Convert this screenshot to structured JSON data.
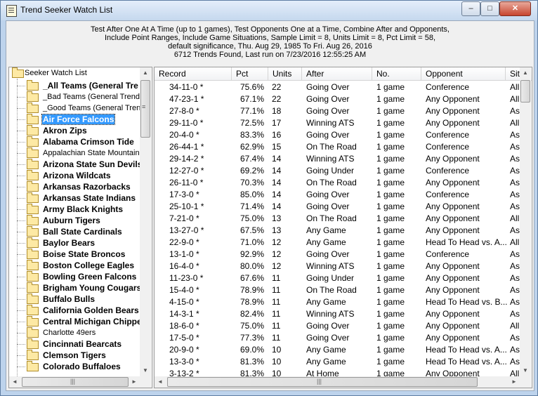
{
  "window": {
    "title": "Trend Seeker Watch List",
    "minimize_glyph": "–",
    "maximize_glyph": "□",
    "close_glyph": "✕"
  },
  "info": {
    "line1": "Test After One At A Time (up to 1 games), Test Opponents One at a Time, Combine After and Opponents,",
    "line2": "Include Point Ranges, Include Game Situations,  Sample Limit = 8,  Units Limit = 8,  Pct Limit = 58,",
    "line3": "default significance, Thu. Aug 29, 1985 To Fri. Aug 26, 2016",
    "line4": "6712 Trends Found, Last run on 7/23/2016 12:55:25 AM"
  },
  "tree": {
    "root_label": "Seeker Watch List",
    "selected_index": 3,
    "items": [
      {
        "label": "_All Teams (General Tre",
        "bold": true
      },
      {
        "label": "_Bad Teams (General Trends",
        "bold": false
      },
      {
        "label": "_Good Teams (General Trend",
        "bold": false
      },
      {
        "label": "Air Force Falcons",
        "bold": true
      },
      {
        "label": "Akron Zips",
        "bold": true
      },
      {
        "label": "Alabama Crimson Tide",
        "bold": true
      },
      {
        "label": "Appalachian State Mountaine",
        "bold": false
      },
      {
        "label": "Arizona State Sun Devils",
        "bold": true
      },
      {
        "label": "Arizona Wildcats",
        "bold": true
      },
      {
        "label": "Arkansas Razorbacks",
        "bold": true
      },
      {
        "label": "Arkansas State Indians",
        "bold": true
      },
      {
        "label": "Army Black Knights",
        "bold": true
      },
      {
        "label": "Auburn Tigers",
        "bold": true
      },
      {
        "label": "Ball State Cardinals",
        "bold": true
      },
      {
        "label": "Baylor Bears",
        "bold": true
      },
      {
        "label": "Boise State Broncos",
        "bold": true
      },
      {
        "label": "Boston College Eagles",
        "bold": true
      },
      {
        "label": "Bowling Green Falcons",
        "bold": true
      },
      {
        "label": "Brigham Young Cougars",
        "bold": true
      },
      {
        "label": "Buffalo Bulls",
        "bold": true
      },
      {
        "label": "California Golden Bears",
        "bold": true
      },
      {
        "label": "Central Michigan Chippe",
        "bold": true
      },
      {
        "label": "Charlotte 49ers",
        "bold": false
      },
      {
        "label": "Cincinnati Bearcats",
        "bold": true
      },
      {
        "label": "Clemson Tigers",
        "bold": true
      },
      {
        "label": "Colorado Buffaloes",
        "bold": true
      }
    ]
  },
  "table": {
    "columns": [
      "Record",
      "Pct",
      "Units",
      "After",
      "No.",
      "Opponent",
      "Situt"
    ],
    "rows": [
      [
        "34-11-0 *",
        "75.6%",
        "22",
        "Going Over",
        "1 game",
        "Conference",
        "All G"
      ],
      [
        "47-23-1 *",
        "67.1%",
        "22",
        "Going Over",
        "1 game",
        "Any Opponent",
        "All G"
      ],
      [
        "27-8-0 *",
        "77.1%",
        "18",
        "Going Over",
        "1 game",
        "Any Opponent",
        "As D"
      ],
      [
        "29-11-0 *",
        "72.5%",
        "17",
        "Winning ATS",
        "1 game",
        "Any Opponent",
        "All G"
      ],
      [
        "20-4-0 *",
        "83.3%",
        "16",
        "Going Over",
        "1 game",
        "Conference",
        "As A"
      ],
      [
        "26-44-1 *",
        "62.9%",
        "15",
        "On The Road",
        "1 game",
        "Conference",
        "As F"
      ],
      [
        "29-14-2 *",
        "67.4%",
        "14",
        "Winning ATS",
        "1 game",
        "Any Opponent",
        "As A"
      ],
      [
        "12-27-0 *",
        "69.2%",
        "14",
        "Going Under",
        "1 game",
        "Conference",
        "As F"
      ],
      [
        "26-11-0 *",
        "70.3%",
        "14",
        "On The Road",
        "1 game",
        "Any Opponent",
        "As A"
      ],
      [
        "17-3-0 *",
        "85.0%",
        "14",
        "Going Over",
        "1 game",
        "Conference",
        "As D"
      ],
      [
        "25-10-1 *",
        "71.4%",
        "14",
        "Going Over",
        "1 game",
        "Any Opponent",
        "As A"
      ],
      [
        "7-21-0 *",
        "75.0%",
        "13",
        "On The Road",
        "1 game",
        "Any Opponent",
        "All G"
      ],
      [
        "13-27-0 *",
        "67.5%",
        "13",
        "Any Game",
        "1 game",
        "Any Opponent",
        "As F"
      ],
      [
        "22-9-0 *",
        "71.0%",
        "12",
        "Any Game",
        "1 game",
        "Head To Head vs. A...",
        "All G"
      ],
      [
        "13-1-0 *",
        "92.9%",
        "12",
        "Going Over",
        "1 game",
        "Conference",
        "As D"
      ],
      [
        "16-4-0 *",
        "80.0%",
        "12",
        "Winning ATS",
        "1 game",
        "Any Opponent",
        "As A"
      ],
      [
        "11-23-0 *",
        "67.6%",
        "11",
        "Going Under",
        "1 game",
        "Any Opponent",
        "As H"
      ],
      [
        "15-4-0 *",
        "78.9%",
        "11",
        "On The Road",
        "1 game",
        "Any Opponent",
        "As A"
      ],
      [
        "4-15-0 *",
        "78.9%",
        "11",
        "Any Game",
        "1 game",
        "Head To Head vs. B...",
        "As H"
      ],
      [
        "14-3-1 *",
        "82.4%",
        "11",
        "Winning ATS",
        "1 game",
        "Any Opponent",
        "As D"
      ],
      [
        "18-6-0 *",
        "75.0%",
        "11",
        "Going Over",
        "1 game",
        "Any Opponent",
        "All G"
      ],
      [
        "17-5-0 *",
        "77.3%",
        "11",
        "Going Over",
        "1 game",
        "Any Opponent",
        "As A"
      ],
      [
        "20-9-0 *",
        "69.0%",
        "10",
        "Any Game",
        "1 game",
        "Head To Head vs. A...",
        "As A"
      ],
      [
        "13-3-0 *",
        "81.3%",
        "10",
        "Any Game",
        "1 game",
        "Head To Head vs. A...",
        "As H"
      ],
      [
        "3-13-2 *",
        "81.3%",
        "10",
        "At Home",
        "1 game",
        "Any Opponent",
        "All G"
      ]
    ]
  },
  "scroll": {
    "up_arrow": "▲",
    "down_arrow": "▼",
    "left_arrow": "◄",
    "right_arrow": "►",
    "grip_v": "≡",
    "grip_h": "|||"
  }
}
